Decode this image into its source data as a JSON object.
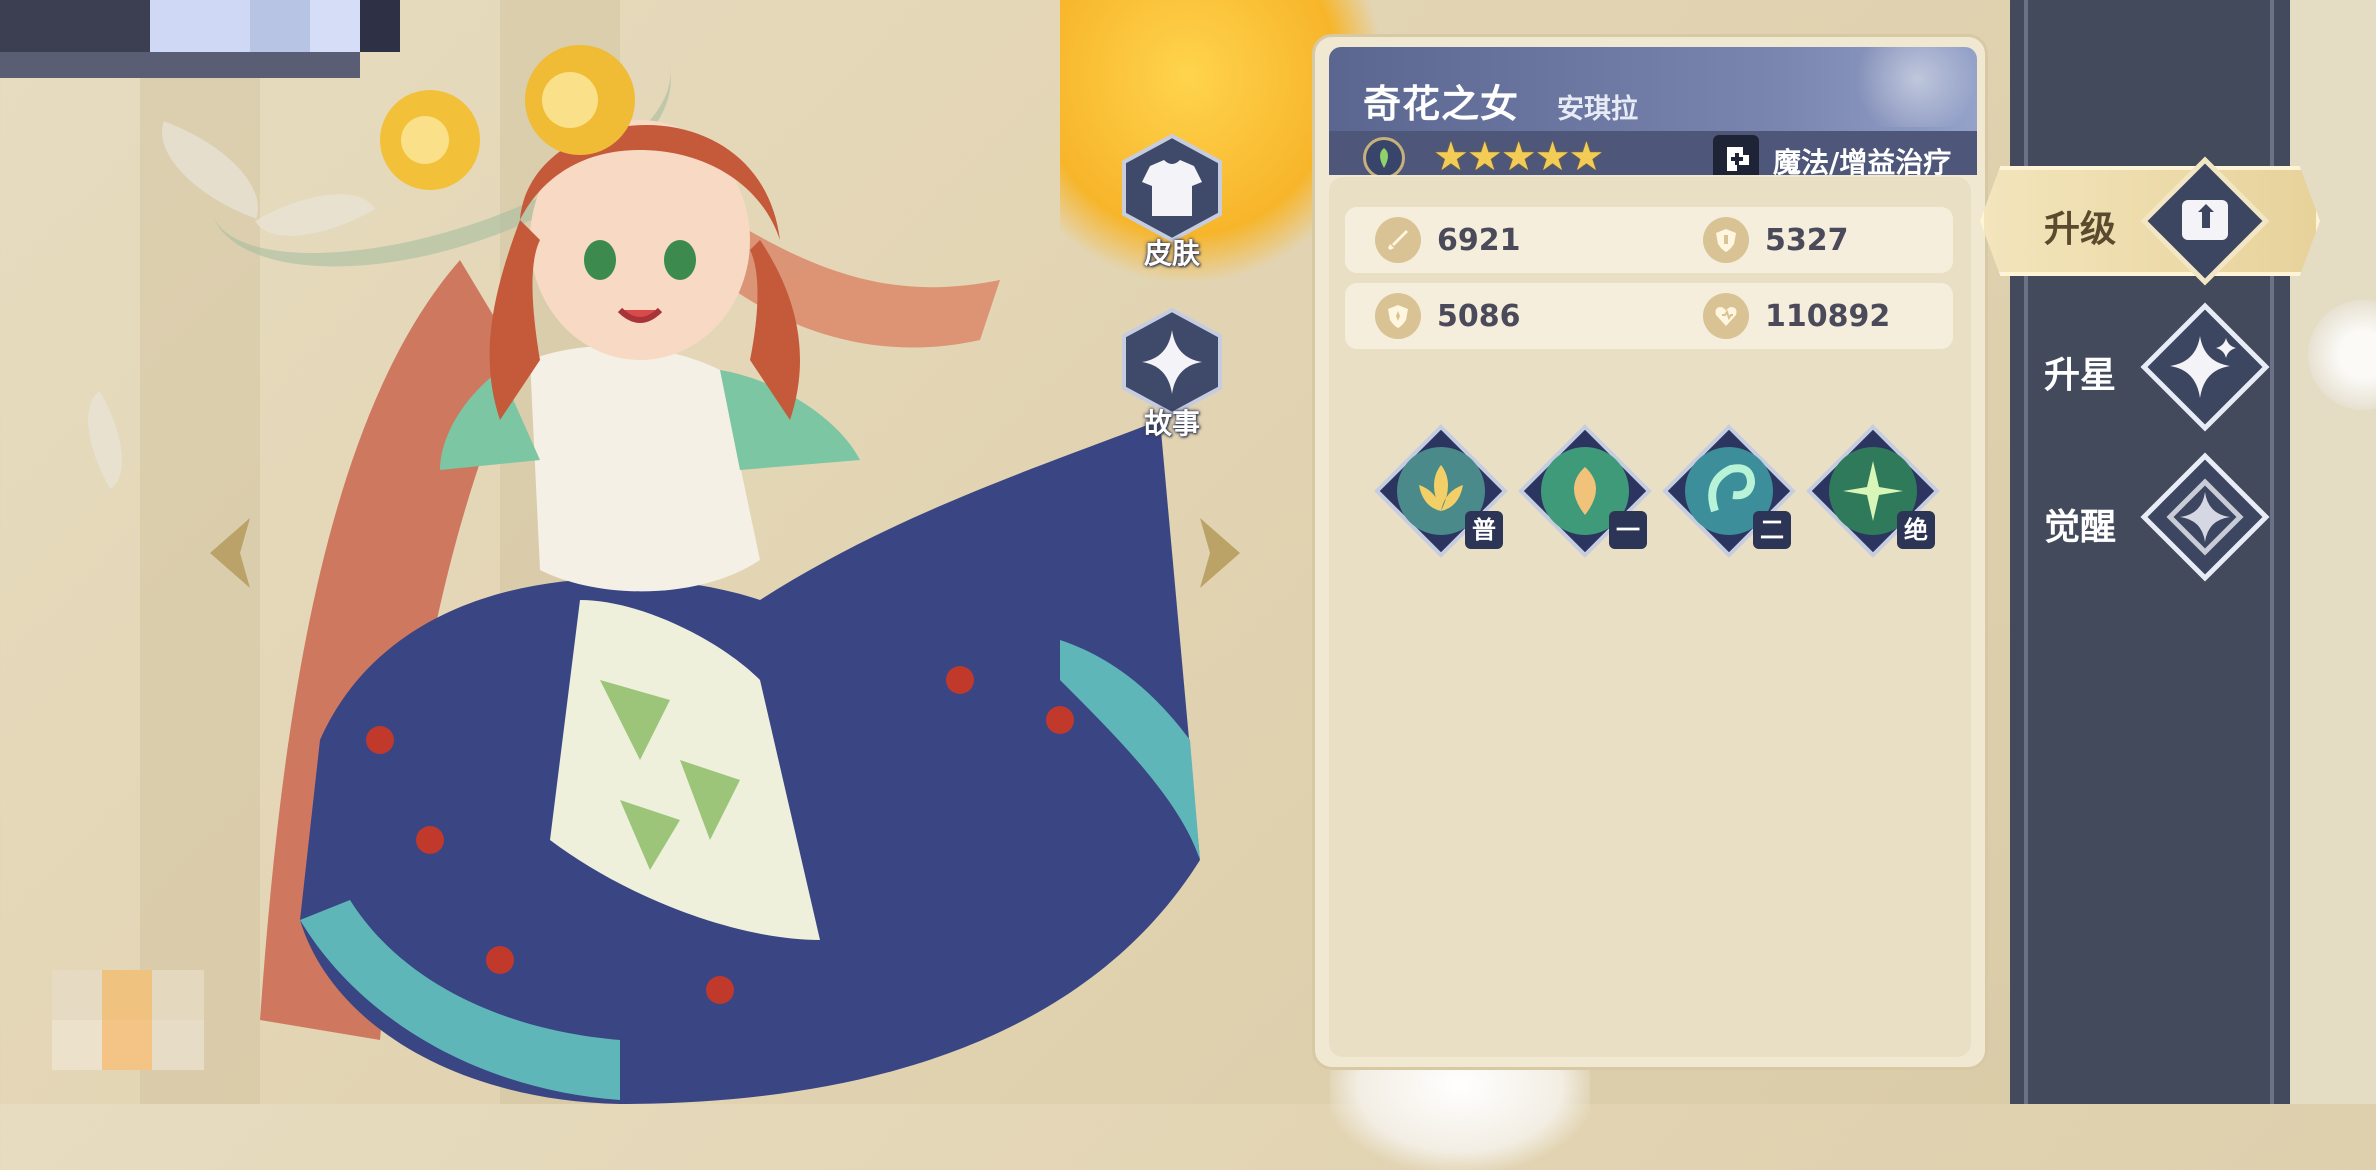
{
  "hero": {
    "name": "奇花之女",
    "subtitle": "安琪拉",
    "stars": "★★★★★",
    "class_text": "魔法/增益治疗"
  },
  "side_actions": {
    "skin": "皮肤",
    "story": "故事"
  },
  "stats": [
    {
      "icon": "sword-icon",
      "value": "6921"
    },
    {
      "icon": "shield-icon",
      "value": "5327"
    },
    {
      "icon": "magic-shield-icon",
      "value": "5086"
    },
    {
      "icon": "heart-icon",
      "value": "110892"
    }
  ],
  "skills": [
    {
      "badge": "普"
    },
    {
      "badge": "一"
    },
    {
      "badge": "二"
    },
    {
      "badge": "绝"
    }
  ],
  "menu": {
    "upgrade": "升级",
    "star_up": "升星",
    "awaken": "觉醒"
  },
  "colors": {
    "panel_bg": "#f1e8d2",
    "header_blue": "#5b6690",
    "sidebar": "#434a5c",
    "gold": "#f3cc56"
  }
}
